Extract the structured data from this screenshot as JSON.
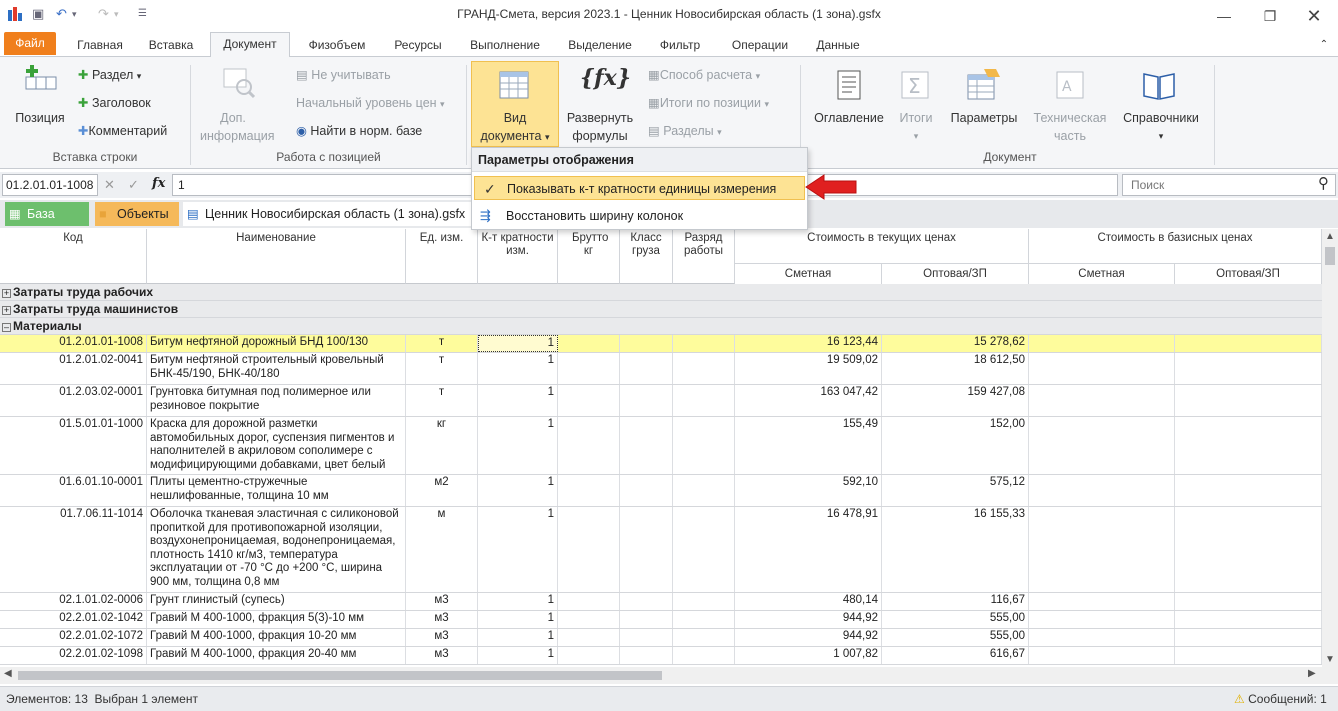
{
  "window": {
    "title": "ГРАНД-Смета, версия 2023.1 - Ценник Новосибирская область (1 зона).gsfx"
  },
  "tabs": [
    "Файл",
    "Главная",
    "Вставка",
    "Документ",
    "Физобъем",
    "Ресурсы",
    "Выполнение",
    "Выделение",
    "Фильтр",
    "Операции",
    "Данные"
  ],
  "ribbon": {
    "pozitsiya": "Позиция",
    "razdel": "Раздел",
    "zagolovok": "Заголовок",
    "kommentariy": "Комментарий",
    "group_insert": "Вставка строки",
    "dop_info_1": "Доп.",
    "dop_info_2": "информация",
    "ne_uchityvat": "Не учитывать",
    "nach_uroven": "Начальный уровень цен",
    "nayti": "Найти в норм. базе",
    "group_position": "Работа с позицией",
    "vid_1": "Вид",
    "vid_2": "документа",
    "razvern_1": "Развернуть",
    "razvern_2": "формулы",
    "sposob": "Способ расчета",
    "itogi_poz": "Итоги по позиции",
    "razdely": "Разделы",
    "oglavlenie": "Оглавление",
    "itogi": "Итоги",
    "parametry": "Параметры",
    "tech_1": "Техническая",
    "tech_2": "часть",
    "spravochniki": "Справочники",
    "group_document": "Документ"
  },
  "formula": {
    "cell": "01.2.01.01-1008",
    "value": "1",
    "search_placeholder": "Поиск"
  },
  "doctabs": {
    "baza": "База",
    "obekty": "Объекты",
    "doc": "Ценник Новосибирская область (1 зона).gsfx"
  },
  "popup": {
    "header": "Параметры отображения",
    "item1": "Показывать к-т кратности единицы измерения",
    "item2": "Восстановить ширину колонок"
  },
  "columns": {
    "code": "Код",
    "name": "Наименование",
    "unit": "Ед. изм.",
    "k": "К-т кратности изм.",
    "brutto": "Брутто кг",
    "klass": "Класс груза",
    "razryad": "Разряд работы",
    "tek": "Стоимость в текущих ценах",
    "baz": "Стоимость в базисных ценах",
    "smetnaya": "Сметная",
    "optovaya": "Оптовая/ЗП"
  },
  "sections": [
    "Затраты труда рабочих",
    "Затраты труда машинистов",
    "Материалы"
  ],
  "rows": [
    {
      "code": "01.2.01.01-1008",
      "name": "Битум нефтяной дорожный БНД 100/130",
      "unit": "т",
      "k": "1",
      "s1": "16 123,44",
      "s2": "15 278,62"
    },
    {
      "code": "01.2.01.02-0041",
      "name": "Битум нефтяной строительный кровельный БНК-45/190, БНК-40/180",
      "unit": "т",
      "k": "1",
      "s1": "19 509,02",
      "s2": "18 612,50"
    },
    {
      "code": "01.2.03.02-0001",
      "name": "Грунтовка битумная под полимерное или резиновое покрытие",
      "unit": "т",
      "k": "1",
      "s1": "163 047,42",
      "s2": "159 427,08"
    },
    {
      "code": "01.5.01.01-1000",
      "name": "Краска для дорожной разметки автомобильных дорог, суспензия пигментов и наполнителей в акриловом сополимере с модифицирующими добавками, цвет белый",
      "unit": "кг",
      "k": "1",
      "s1": "155,49",
      "s2": "152,00"
    },
    {
      "code": "01.6.01.10-0001",
      "name": "Плиты цементно-стружечные нешлифованные, толщина 10 мм",
      "unit": "м2",
      "k": "1",
      "s1": "592,10",
      "s2": "575,12"
    },
    {
      "code": "01.7.06.11-1014",
      "name": "Оболочка тканевая эластичная с силиконовой пропиткой для противопожарной изоляции, воздухонепроницаемая, водонепроницаемая, плотность 1410 кг/м3, температура эксплуатации от -70 °С до +200 °С, ширина 900 мм, толщина 0,8 мм",
      "unit": "м",
      "k": "1",
      "s1": "16 478,91",
      "s2": "16 155,33"
    },
    {
      "code": "02.1.01.02-0006",
      "name": "Грунт глинистый (супесь)",
      "unit": "м3",
      "k": "1",
      "s1": "480,14",
      "s2": "116,67"
    },
    {
      "code": "02.2.01.02-1042",
      "name": "Гравий М 400-1000, фракция 5(3)-10 мм",
      "unit": "м3",
      "k": "1",
      "s1": "944,92",
      "s2": "555,00"
    },
    {
      "code": "02.2.01.02-1072",
      "name": "Гравий М 400-1000, фракция 10-20 мм",
      "unit": "м3",
      "k": "1",
      "s1": "944,92",
      "s2": "555,00"
    },
    {
      "code": "02.2.01.02-1098",
      "name": "Гравий М 400-1000, фракция 20-40 мм",
      "unit": "м3",
      "k": "1",
      "s1": "1 007,82",
      "s2": "616,67"
    }
  ],
  "status": {
    "left": "Элементов: 13  Выбран 1 элемент",
    "right": "Сообщений: 1"
  },
  "colors": {
    "accent": "#f07f1c",
    "selection": "#fefc9c",
    "highlight": "#fde394",
    "arrow": "#e02020"
  }
}
